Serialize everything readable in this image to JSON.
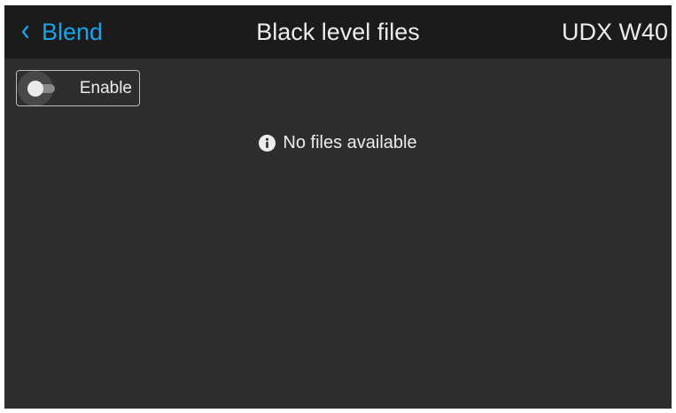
{
  "header": {
    "back_label": "Blend",
    "back_icon": "chevron-left-icon",
    "title": "Black level files",
    "device_name": "UDX W40"
  },
  "toggle": {
    "label": "Enable",
    "checked": false
  },
  "empty_state": {
    "icon": "info-icon",
    "message": "No files available"
  },
  "colors": {
    "background": "#2d2d2d",
    "header_background": "#1b1b1b",
    "accent": "#1aa3e8",
    "text": "#ececec"
  }
}
